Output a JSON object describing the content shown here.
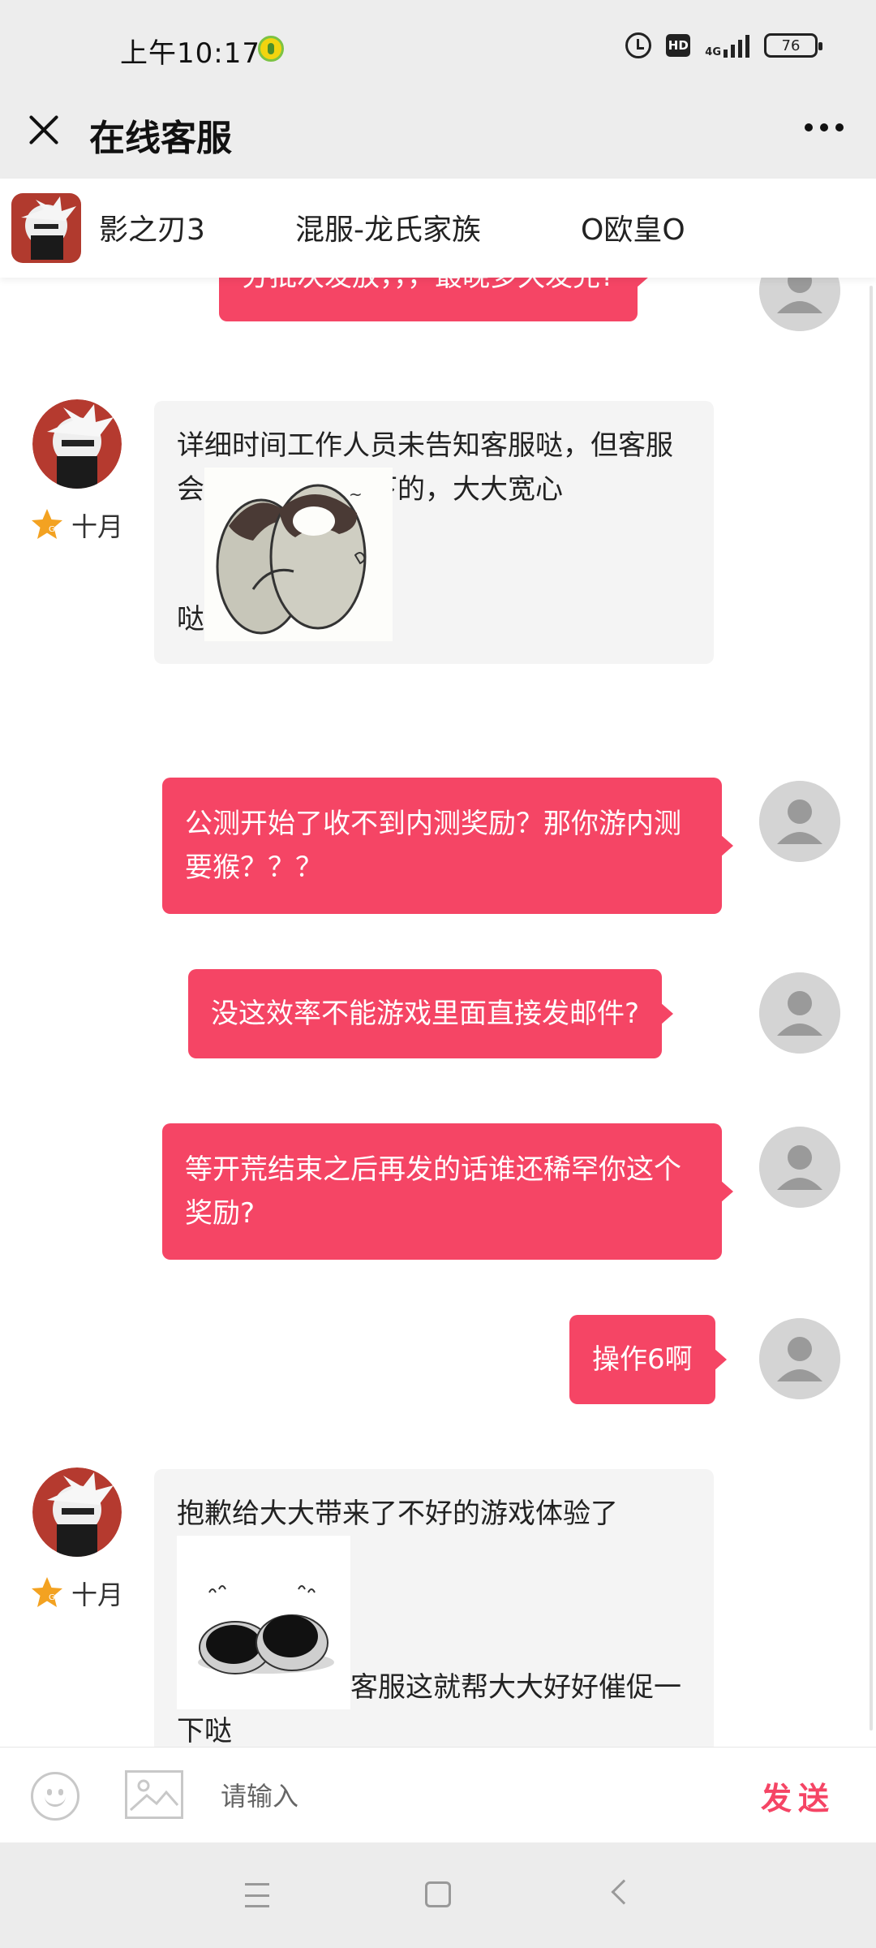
{
  "status_bar": {
    "time": "上午10:17",
    "hd_label": "HD",
    "network_label": "4G",
    "battery": "76"
  },
  "header": {
    "title": "在线客服"
  },
  "game_bar": {
    "game_name": "影之刃3",
    "server_name": "混服-龙氏家族",
    "role_name": "O欧皇O"
  },
  "messages": [
    {
      "side": "user",
      "text": "分批次发放，，，最晚多久发完?"
    },
    {
      "side": "agent",
      "name": "十月",
      "text_before": "详细时间工作人员未告知客服哒，但客服会帮大大催促一下的，大大宽心",
      "text_after": "哒",
      "sticker": "penguin-hug-sticker"
    },
    {
      "side": "user",
      "text": "公测开始了收不到内测奖励？那你游内测要猴？？？"
    },
    {
      "side": "user",
      "text": "没这效率不能游戏里面直接发邮件?"
    },
    {
      "side": "user",
      "text": "等开荒结束之后再发的话谁还稀罕你这个奖励?"
    },
    {
      "side": "user",
      "text": "操作6啊"
    },
    {
      "side": "agent",
      "name": "十月",
      "text_before": "抱歉给大大带来了不好的游戏体验了",
      "text_after": "客服这就帮大大好好催促一下哒",
      "sticker": "penguin-bow-sticker"
    }
  ],
  "input_bar": {
    "placeholder": "请输入",
    "send_label": "发送"
  },
  "colors": {
    "accent": "#f54565",
    "agent_bubble": "#f4f4f4",
    "header_bg": "#ededed"
  }
}
